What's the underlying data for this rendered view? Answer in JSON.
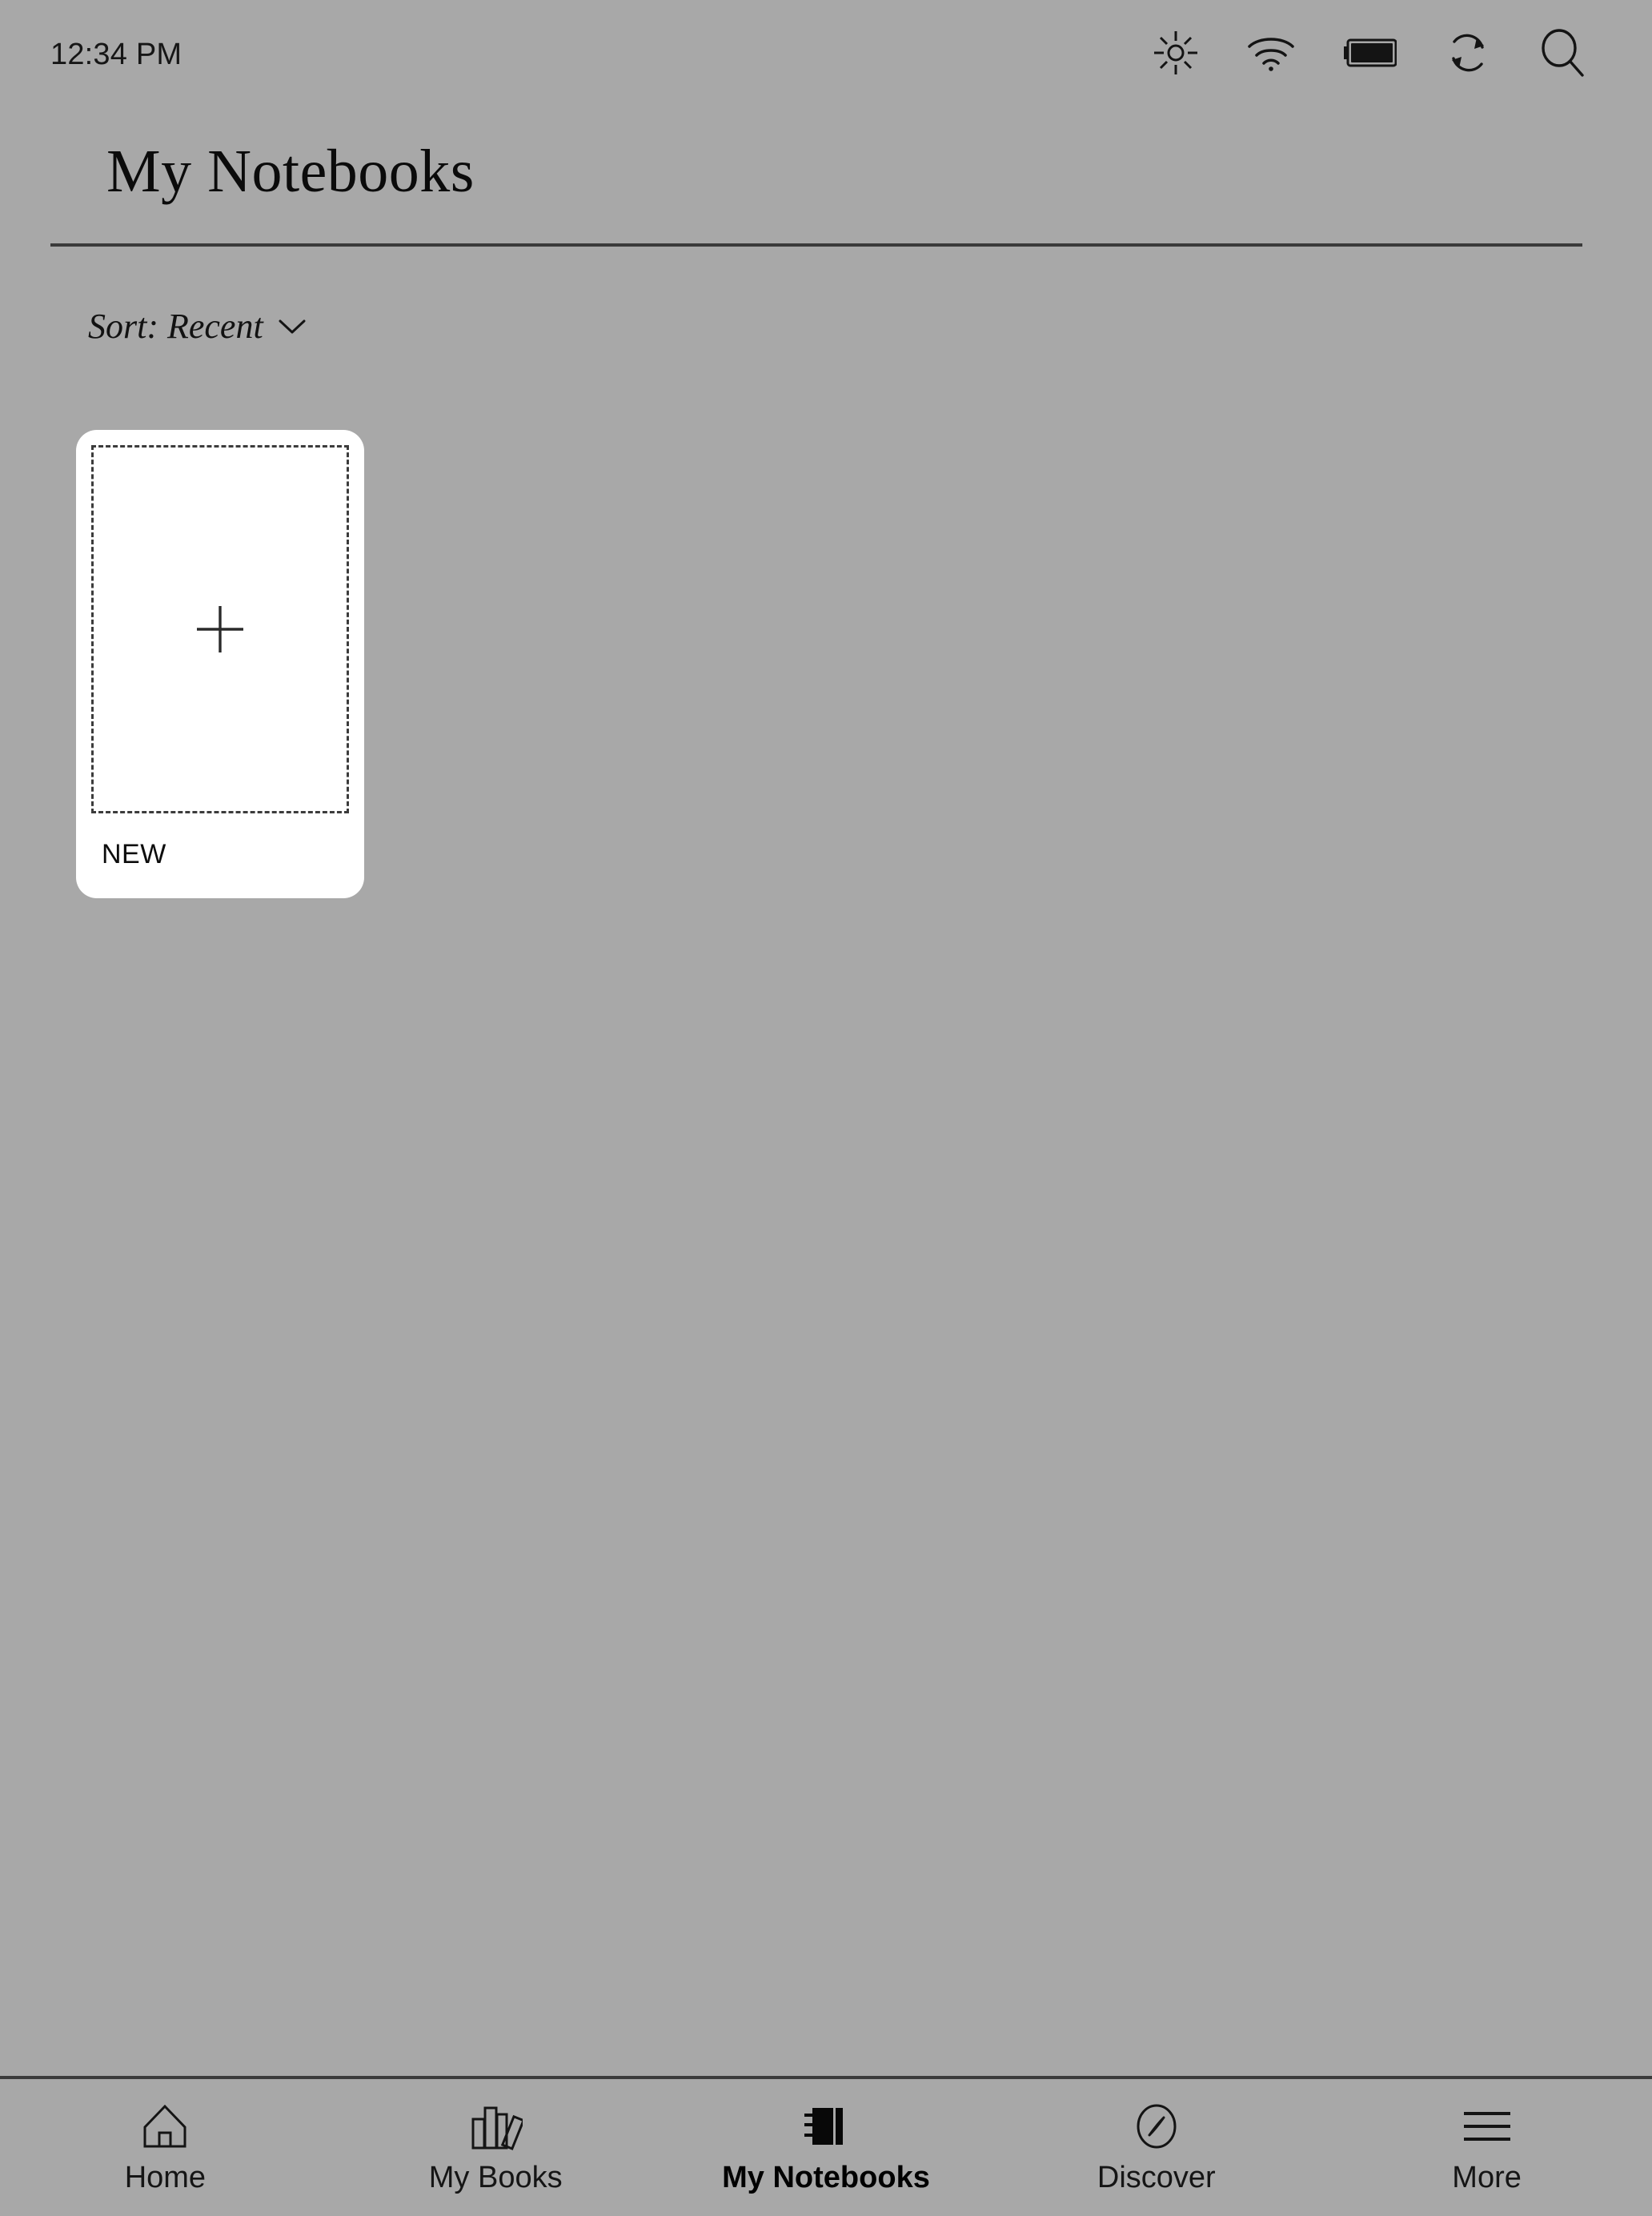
{
  "status_bar": {
    "time": "12:34 PM",
    "icons": [
      {
        "name": "brightness-icon",
        "label": "brightness"
      },
      {
        "name": "wifi-icon",
        "label": "wifi"
      },
      {
        "name": "battery-icon",
        "label": "battery"
      },
      {
        "name": "sync-icon",
        "label": "sync"
      },
      {
        "name": "search-icon",
        "label": "search"
      }
    ]
  },
  "header": {
    "title": "My Notebooks"
  },
  "sort": {
    "label": "Sort: Recent",
    "chevron_icon": "chevron-down-icon",
    "options": [
      "Recent"
    ]
  },
  "notebooks": [
    {
      "label": "NEW",
      "icon": "plus-icon",
      "is_new_placeholder": true
    }
  ],
  "bottom_nav": {
    "items": [
      {
        "label": "Home",
        "icon": "home-icon",
        "active": false
      },
      {
        "label": "My Books",
        "icon": "books-icon",
        "active": false
      },
      {
        "label": "My Notebooks",
        "icon": "notebook-icon",
        "active": true
      },
      {
        "label": "Discover",
        "icon": "compass-icon",
        "active": false
      },
      {
        "label": "More",
        "icon": "hamburger-menu-icon",
        "active": false
      }
    ]
  },
  "colors": {
    "background": "#a8a8a8",
    "card_background": "#ffffff",
    "foreground": "#111111",
    "divider": "#3a3a3a"
  }
}
